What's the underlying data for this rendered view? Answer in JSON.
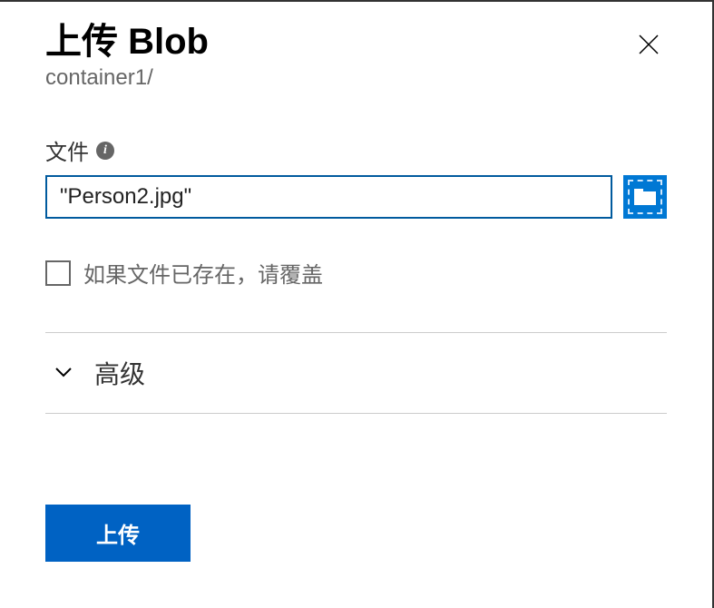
{
  "header": {
    "title": "上传 Blob",
    "breadcrumb": "container1/"
  },
  "file_field": {
    "label": "文件",
    "value": "\"Person2.jpg\""
  },
  "overwrite": {
    "label": "如果文件已存在，请覆盖"
  },
  "advanced": {
    "label": "高级"
  },
  "actions": {
    "upload": "上传"
  },
  "icons": {
    "info": "i",
    "chevron": "⌄"
  }
}
